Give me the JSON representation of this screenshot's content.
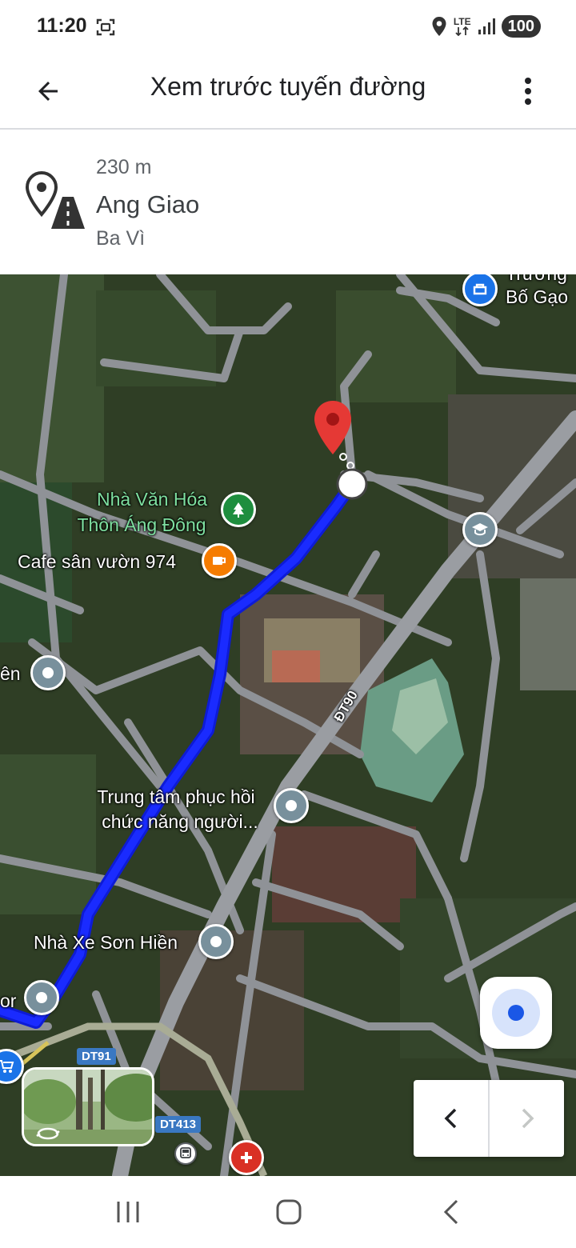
{
  "status_bar": {
    "time": "11:20",
    "network": "LTE",
    "battery": "100",
    "icons": [
      "screen-capture-icon",
      "location-icon",
      "lte-icon",
      "signal-icon",
      "battery-icon"
    ]
  },
  "app_bar": {
    "title": "Xem trước tuyến đường",
    "back_icon": "arrow-back-icon",
    "more_icon": "more-vert-icon"
  },
  "step": {
    "distance": "230 m",
    "name": "Ang Giao",
    "sub": "Ba Vì",
    "icon": "destination-road-icon"
  },
  "map": {
    "labels": {
      "truong": "Trường",
      "bo_gao": "Bố Gạo",
      "nha_van_hoa_1": "Nhà Văn Hóa",
      "nha_van_hoa_2": "Thôn Áng Đông",
      "cafe": "Cafe sân vườn 974",
      "en": "ên",
      "trung_tam_1": "Trung tâm phục hồi",
      "trung_tam_2": "chức năng người...",
      "nha_xe": "Nhà Xe Sơn Hiền",
      "or": "or"
    },
    "road_shields": {
      "dt190": "ĐT90",
      "dt91": "DT91",
      "dt413": "DT413"
    },
    "colors": {
      "route": "#1a2bff",
      "destination_pin": "#e53935",
      "poi_gray": "#78909c",
      "poi_green": "#1e8e3e",
      "poi_orange": "#f57c00",
      "poi_blue": "#1a73e8",
      "poi_red": "#d93025"
    }
  },
  "controls": {
    "my_location_icon": "my-location-icon",
    "prev_icon": "chevron-left-icon",
    "next_icon": "chevron-right-icon"
  },
  "nav_bar": {
    "icons": [
      "recent-apps-icon",
      "home-icon",
      "back-icon"
    ]
  }
}
